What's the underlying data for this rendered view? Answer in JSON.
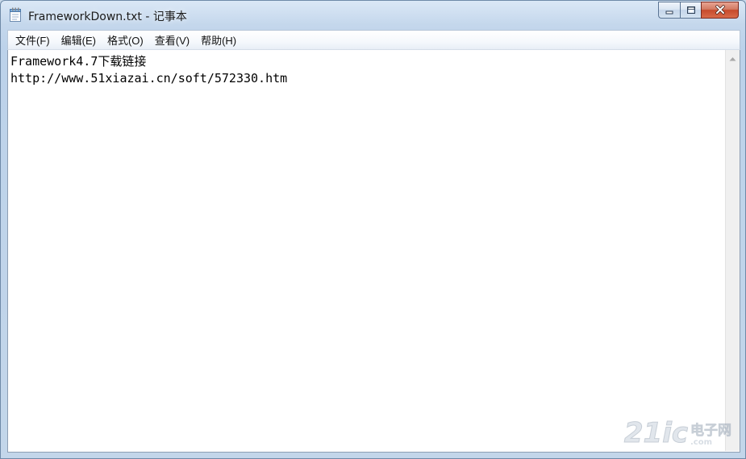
{
  "window": {
    "title": "FrameworkDown.txt - 记事本"
  },
  "icons": {
    "app": "notepad-icon",
    "minimize": "minimize-icon",
    "maximize": "maximize-icon",
    "close": "close-icon",
    "scroll_up": "scroll-up-arrow-icon"
  },
  "menu": {
    "items": [
      {
        "label": "文件(F)"
      },
      {
        "label": "编辑(E)"
      },
      {
        "label": "格式(O)"
      },
      {
        "label": "查看(V)"
      },
      {
        "label": "帮助(H)"
      }
    ]
  },
  "document": {
    "lines": [
      "Framework4.7下载链接",
      "http://www.51xiazai.cn/soft/572330.htm"
    ]
  },
  "watermark": {
    "big": "21ic",
    "cn": "电子网",
    "domain": ".com"
  },
  "colors": {
    "close_button": "#c74a2c",
    "titlebar": "#c4d7ec"
  }
}
